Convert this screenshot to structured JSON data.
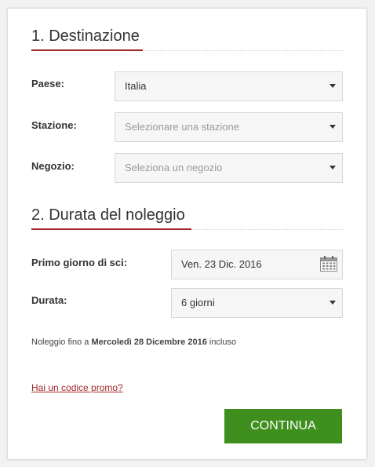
{
  "section1": {
    "title": "1. Destinazione",
    "country": {
      "label": "Paese:",
      "value": "Italia"
    },
    "station": {
      "label": "Stazione:",
      "placeholder": "Selezionare una stazione"
    },
    "shop": {
      "label": "Negozio:",
      "placeholder": "Seleziona un negozio"
    }
  },
  "section2": {
    "title": "2. Durata del noleggio",
    "first_day": {
      "label": "Primo giorno di sci:",
      "value": "Ven. 23 Dic. 2016",
      "icon": "calendar-icon"
    },
    "duration": {
      "label": "Durata:",
      "value": "6 giorni"
    },
    "note": {
      "prefix": "Noleggio fino a ",
      "date": "Mercoledì 28 Dicembre 2016",
      "suffix": " incluso"
    }
  },
  "promo_link": "Hai un codice promo?",
  "continue_button": "CONTINUA",
  "colors": {
    "accent": "#a3262a",
    "button": "#3f8f1e"
  }
}
